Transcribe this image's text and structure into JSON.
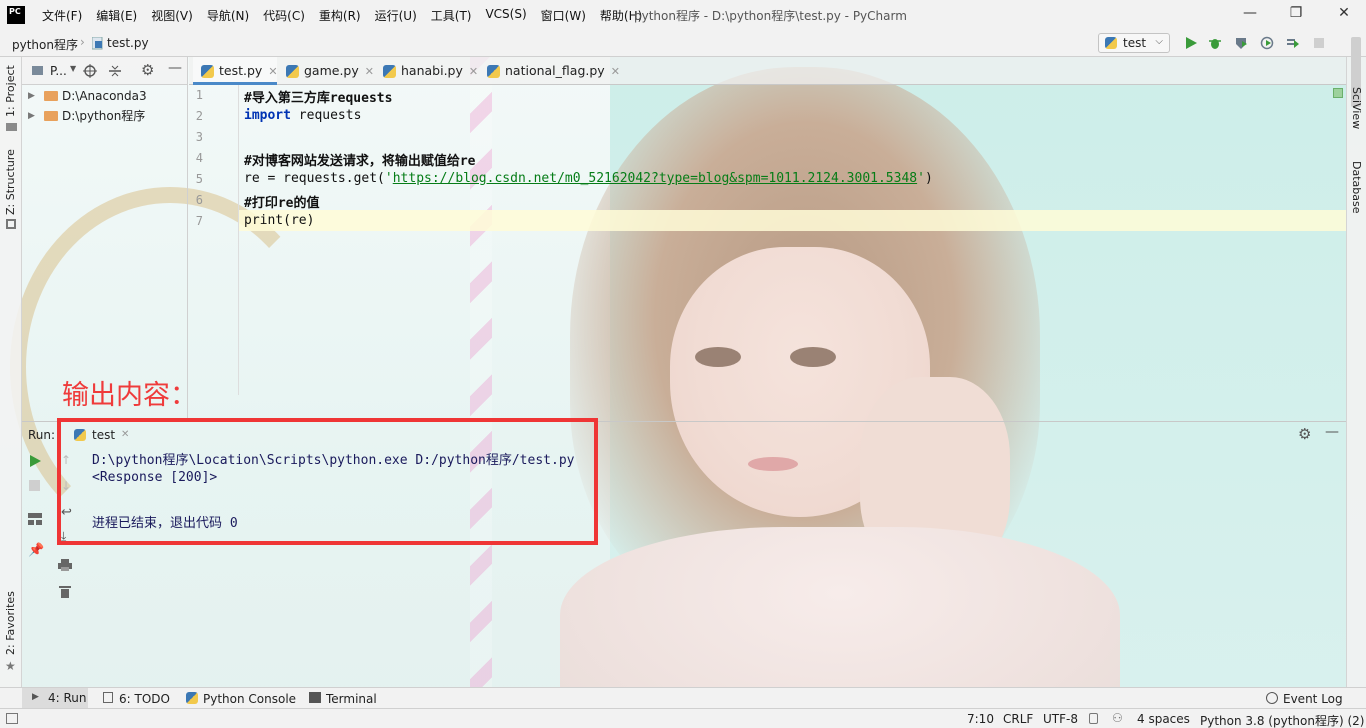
{
  "window": {
    "title": "python程序 - D:\\python程序\\test.py - PyCharm",
    "logo": "PC",
    "menu": [
      "文件(F)",
      "编辑(E)",
      "视图(V)",
      "导航(N)",
      "代码(C)",
      "重构(R)",
      "运行(U)",
      "工具(T)",
      "VCS(S)",
      "窗口(W)",
      "帮助(H)"
    ],
    "controls": {
      "minimize": "—",
      "maximize": "❐",
      "close": "✕"
    }
  },
  "navbar": {
    "breadcrumb": [
      "python程序",
      "test.py"
    ],
    "run_config": "test"
  },
  "left_stripe": {
    "project": "1: Project",
    "structure": "Z: Structure",
    "favorites": "2: Favorites"
  },
  "right_stripe": {
    "sciview": "SciView",
    "database": "Database"
  },
  "project_panel": {
    "title": "P...",
    "items": [
      {
        "label": "D:\\Anaconda3"
      },
      {
        "label": "D:\\python程序"
      }
    ]
  },
  "tabs": [
    {
      "label": "test.py",
      "active": true
    },
    {
      "label": "game.py",
      "active": false
    },
    {
      "label": "hanabi.py",
      "active": false
    },
    {
      "label": "national_flag.py",
      "active": false
    }
  ],
  "editor": {
    "line_numbers": [
      "1",
      "2",
      "3",
      "4",
      "5",
      "6",
      "7"
    ],
    "line1": "#导入第三方库requests",
    "line2_kw": "import",
    "line2_rest": " requests",
    "line4": "#对博客网站发送请求，将输出赋值给re",
    "line5_pre": "re = requests.get(",
    "line5_q1": "'",
    "line5_url": "https://blog.csdn.net/m0_52162042?type=blog&spm=1011.2124.3001.5348",
    "line5_q2": "'",
    "line5_post": ")",
    "line6": "#打印re的值",
    "line7": "print(re)"
  },
  "run_panel": {
    "label": "Run:",
    "tab": "test",
    "output": [
      "D:\\python程序\\Location\\Scripts\\python.exe D:/python程序/test.py",
      "<Response [200]>",
      "",
      "进程已结束，退出代码 0"
    ]
  },
  "annotation": {
    "label": "输出内容：",
    "color": "#ef3535"
  },
  "bottom_tools": {
    "run": "4: Run",
    "todo": "6: TODO",
    "console": "Python Console",
    "terminal": "Terminal",
    "event_log": "Event Log"
  },
  "status_bar": {
    "position": "7:10",
    "line_sep": "CRLF",
    "encoding": "UTF-8",
    "indent": "4 spaces",
    "interpreter": "Python 3.8 (python程序) (2)"
  },
  "colors": {
    "accent": "#4a89c8",
    "keyword": "#0033b3",
    "string": "#067d17",
    "run_green": "#3a9b3a"
  }
}
